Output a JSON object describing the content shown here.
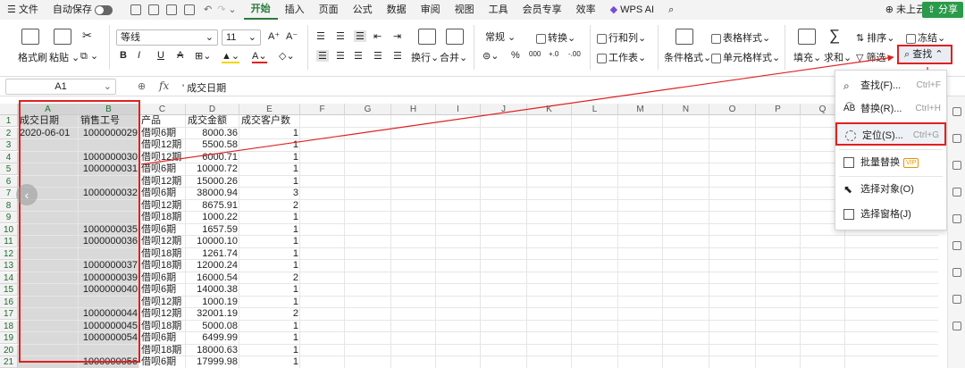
{
  "menubar": {
    "file": "文件",
    "autosave": "自动保存",
    "tabs": [
      "开始",
      "插入",
      "页面",
      "公式",
      "数据",
      "审阅",
      "视图",
      "工具",
      "会员专享",
      "效率"
    ],
    "wps_ai": "WPS AI",
    "cloud": "未上云",
    "share": "分享"
  },
  "ribbon": {
    "format_painter": "格式刷",
    "paste": "粘贴",
    "font_name": "等线",
    "font_size": "11",
    "number_format": "常规",
    "convert": "转换",
    "rows_cols": "行和列",
    "worksheet": "工作表",
    "wrap": "换行",
    "merge": "合并",
    "cond_format": "条件格式",
    "table_style": "表格样式",
    "cell_style": "单元格样式",
    "fill": "填充",
    "sum": "求和",
    "filter": "筛选",
    "sort": "排序",
    "freeze": "冻结",
    "find": "查找"
  },
  "formula_bar": {
    "cell_ref": "A1",
    "fx": "fx",
    "content": "' 成交日期"
  },
  "columns": [
    "A",
    "B",
    "C",
    "D",
    "E",
    "F",
    "G",
    "H",
    "I",
    "J",
    "K",
    "L",
    "M",
    "N",
    "O",
    "P",
    "Q"
  ],
  "rows": [
    {
      "n": "1",
      "a": "成交日期",
      "b": "销售工号",
      "c": "产品",
      "d": "成交金额",
      "e": "成交客户数"
    },
    {
      "n": "2",
      "a": "2020-06-01",
      "b": "1000000029",
      "c": "借呗6期",
      "d": "8000.36",
      "e": "1"
    },
    {
      "n": "3",
      "a": "",
      "b": "",
      "c": "借呗12期",
      "d": "5500.58",
      "e": "1"
    },
    {
      "n": "4",
      "a": "",
      "b": "1000000030",
      "c": "借呗12期",
      "d": "6000.71",
      "e": "1"
    },
    {
      "n": "5",
      "a": "",
      "b": "1000000031",
      "c": "借呗6期",
      "d": "10000.72",
      "e": "1"
    },
    {
      "n": "6",
      "a": "",
      "b": "",
      "c": "借呗12期",
      "d": "15000.26",
      "e": "1"
    },
    {
      "n": "7",
      "a": "",
      "b": "1000000032",
      "c": "借呗6期",
      "d": "38000.94",
      "e": "3"
    },
    {
      "n": "8",
      "a": "",
      "b": "",
      "c": "借呗12期",
      "d": "8675.91",
      "e": "2"
    },
    {
      "n": "9",
      "a": "",
      "b": "",
      "c": "借呗18期",
      "d": "1000.22",
      "e": "1"
    },
    {
      "n": "10",
      "a": "",
      "b": "1000000035",
      "c": "借呗6期",
      "d": "1657.59",
      "e": "1"
    },
    {
      "n": "11",
      "a": "",
      "b": "1000000036",
      "c": "借呗12期",
      "d": "10000.10",
      "e": "1"
    },
    {
      "n": "12",
      "a": "",
      "b": "",
      "c": "借呗18期",
      "d": "1261.74",
      "e": "1"
    },
    {
      "n": "13",
      "a": "",
      "b": "1000000037",
      "c": "借呗18期",
      "d": "12000.24",
      "e": "1"
    },
    {
      "n": "14",
      "a": "",
      "b": "1000000039",
      "c": "借呗6期",
      "d": "16000.54",
      "e": "2"
    },
    {
      "n": "15",
      "a": "",
      "b": "1000000040",
      "c": "借呗6期",
      "d": "14000.38",
      "e": "1"
    },
    {
      "n": "16",
      "a": "",
      "b": "",
      "c": "借呗12期",
      "d": "1000.19",
      "e": "1"
    },
    {
      "n": "17",
      "a": "",
      "b": "1000000044",
      "c": "借呗12期",
      "d": "32001.19",
      "e": "2"
    },
    {
      "n": "18",
      "a": "",
      "b": "1000000045",
      "c": "借呗18期",
      "d": "5000.08",
      "e": "1"
    },
    {
      "n": "19",
      "a": "",
      "b": "1000000054",
      "c": "借呗6期",
      "d": "6499.99",
      "e": "1"
    },
    {
      "n": "20",
      "a": "",
      "b": "",
      "c": "借呗18期",
      "d": "18000.63",
      "e": "1"
    },
    {
      "n": "21",
      "a": "",
      "b": "1000000056",
      "c": "借呗6期",
      "d": "17999.98",
      "e": "1"
    }
  ],
  "dropdown": {
    "items": [
      {
        "label": "查找(F)...",
        "shortcut": "Ctrl+F"
      },
      {
        "label": "替换(R)...",
        "shortcut": "Ctrl+H"
      },
      {
        "label": "定位(S)...",
        "shortcut": "Ctrl+G"
      },
      {
        "label": "批量替换",
        "vip": "VIP"
      },
      {
        "label": "选择对象(O)"
      },
      {
        "label": "选择窗格(J)"
      }
    ]
  },
  "colors": {
    "accent_green": "#2b7b3a",
    "highlight_red": "#e02020",
    "selection_gray": "#d9d9d9"
  }
}
